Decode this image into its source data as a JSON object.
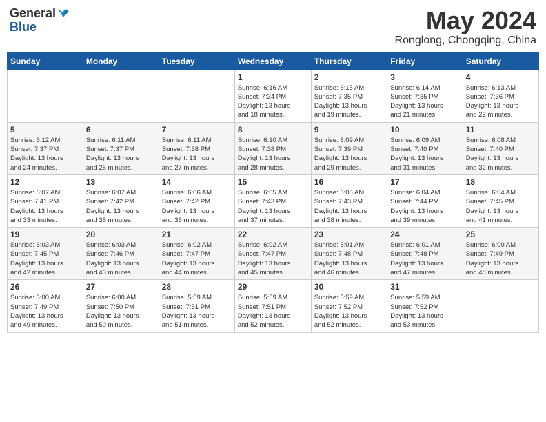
{
  "header": {
    "logo_general": "General",
    "logo_blue": "Blue",
    "month_title": "May 2024",
    "location": "Ronglong, Chongqing, China"
  },
  "days_of_week": [
    "Sunday",
    "Monday",
    "Tuesday",
    "Wednesday",
    "Thursday",
    "Friday",
    "Saturday"
  ],
  "weeks": [
    [
      {
        "day": "",
        "content": ""
      },
      {
        "day": "",
        "content": ""
      },
      {
        "day": "",
        "content": ""
      },
      {
        "day": "1",
        "content": "Sunrise: 6:16 AM\nSunset: 7:34 PM\nDaylight: 13 hours\nand 18 minutes."
      },
      {
        "day": "2",
        "content": "Sunrise: 6:15 AM\nSunset: 7:35 PM\nDaylight: 13 hours\nand 19 minutes."
      },
      {
        "day": "3",
        "content": "Sunrise: 6:14 AM\nSunset: 7:35 PM\nDaylight: 13 hours\nand 21 minutes."
      },
      {
        "day": "4",
        "content": "Sunrise: 6:13 AM\nSunset: 7:36 PM\nDaylight: 13 hours\nand 22 minutes."
      }
    ],
    [
      {
        "day": "5",
        "content": "Sunrise: 6:12 AM\nSunset: 7:37 PM\nDaylight: 13 hours\nand 24 minutes."
      },
      {
        "day": "6",
        "content": "Sunrise: 6:11 AM\nSunset: 7:37 PM\nDaylight: 13 hours\nand 25 minutes."
      },
      {
        "day": "7",
        "content": "Sunrise: 6:11 AM\nSunset: 7:38 PM\nDaylight: 13 hours\nand 27 minutes."
      },
      {
        "day": "8",
        "content": "Sunrise: 6:10 AM\nSunset: 7:38 PM\nDaylight: 13 hours\nand 28 minutes."
      },
      {
        "day": "9",
        "content": "Sunrise: 6:09 AM\nSunset: 7:39 PM\nDaylight: 13 hours\nand 29 minutes."
      },
      {
        "day": "10",
        "content": "Sunrise: 6:09 AM\nSunset: 7:40 PM\nDaylight: 13 hours\nand 31 minutes."
      },
      {
        "day": "11",
        "content": "Sunrise: 6:08 AM\nSunset: 7:40 PM\nDaylight: 13 hours\nand 32 minutes."
      }
    ],
    [
      {
        "day": "12",
        "content": "Sunrise: 6:07 AM\nSunset: 7:41 PM\nDaylight: 13 hours\nand 33 minutes."
      },
      {
        "day": "13",
        "content": "Sunrise: 6:07 AM\nSunset: 7:42 PM\nDaylight: 13 hours\nand 35 minutes."
      },
      {
        "day": "14",
        "content": "Sunrise: 6:06 AM\nSunset: 7:42 PM\nDaylight: 13 hours\nand 36 minutes."
      },
      {
        "day": "15",
        "content": "Sunrise: 6:05 AM\nSunset: 7:43 PM\nDaylight: 13 hours\nand 37 minutes."
      },
      {
        "day": "16",
        "content": "Sunrise: 6:05 AM\nSunset: 7:43 PM\nDaylight: 13 hours\nand 38 minutes."
      },
      {
        "day": "17",
        "content": "Sunrise: 6:04 AM\nSunset: 7:44 PM\nDaylight: 13 hours\nand 39 minutes."
      },
      {
        "day": "18",
        "content": "Sunrise: 6:04 AM\nSunset: 7:45 PM\nDaylight: 13 hours\nand 41 minutes."
      }
    ],
    [
      {
        "day": "19",
        "content": "Sunrise: 6:03 AM\nSunset: 7:45 PM\nDaylight: 13 hours\nand 42 minutes."
      },
      {
        "day": "20",
        "content": "Sunrise: 6:03 AM\nSunset: 7:46 PM\nDaylight: 13 hours\nand 43 minutes."
      },
      {
        "day": "21",
        "content": "Sunrise: 6:02 AM\nSunset: 7:47 PM\nDaylight: 13 hours\nand 44 minutes."
      },
      {
        "day": "22",
        "content": "Sunrise: 6:02 AM\nSunset: 7:47 PM\nDaylight: 13 hours\nand 45 minutes."
      },
      {
        "day": "23",
        "content": "Sunrise: 6:01 AM\nSunset: 7:48 PM\nDaylight: 13 hours\nand 46 minutes."
      },
      {
        "day": "24",
        "content": "Sunrise: 6:01 AM\nSunset: 7:48 PM\nDaylight: 13 hours\nand 47 minutes."
      },
      {
        "day": "25",
        "content": "Sunrise: 6:00 AM\nSunset: 7:49 PM\nDaylight: 13 hours\nand 48 minutes."
      }
    ],
    [
      {
        "day": "26",
        "content": "Sunrise: 6:00 AM\nSunset: 7:49 PM\nDaylight: 13 hours\nand 49 minutes."
      },
      {
        "day": "27",
        "content": "Sunrise: 6:00 AM\nSunset: 7:50 PM\nDaylight: 13 hours\nand 50 minutes."
      },
      {
        "day": "28",
        "content": "Sunrise: 5:59 AM\nSunset: 7:51 PM\nDaylight: 13 hours\nand 51 minutes."
      },
      {
        "day": "29",
        "content": "Sunrise: 5:59 AM\nSunset: 7:51 PM\nDaylight: 13 hours\nand 52 minutes."
      },
      {
        "day": "30",
        "content": "Sunrise: 5:59 AM\nSunset: 7:52 PM\nDaylight: 13 hours\nand 52 minutes."
      },
      {
        "day": "31",
        "content": "Sunrise: 5:59 AM\nSunset: 7:52 PM\nDaylight: 13 hours\nand 53 minutes."
      },
      {
        "day": "",
        "content": ""
      }
    ]
  ]
}
